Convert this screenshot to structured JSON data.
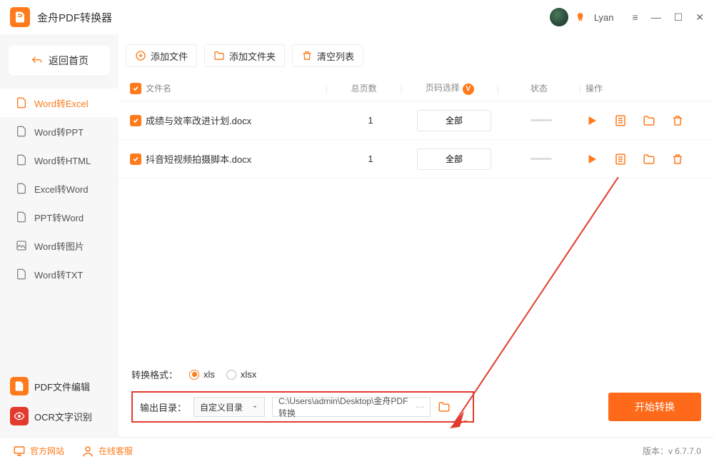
{
  "app": {
    "title": "金舟PDF转换器",
    "username": "Lyan"
  },
  "sidebar": {
    "back_label": "返回首页",
    "items": [
      {
        "label": "Word转Excel"
      },
      {
        "label": "Word转PPT"
      },
      {
        "label": "Word转HTML"
      },
      {
        "label": "Excel转Word"
      },
      {
        "label": "PPT转Word"
      },
      {
        "label": "Word转图片"
      },
      {
        "label": "Word转TXT"
      }
    ],
    "tools": [
      {
        "label": "PDF文件编辑"
      },
      {
        "label": "OCR文字识别"
      }
    ]
  },
  "toolbar": {
    "add_file": "添加文件",
    "add_folder": "添加文件夹",
    "clear_list": "清空列表"
  },
  "columns": {
    "name": "文件名",
    "pages": "总页数",
    "range": "页码选择",
    "status": "状态",
    "ops": "操作"
  },
  "rows": [
    {
      "name": "成绩与效率改进计划.docx",
      "pages": "1",
      "range": "全部"
    },
    {
      "name": "抖音短视频拍摄脚本.docx",
      "pages": "1",
      "range": "全部"
    }
  ],
  "format": {
    "label": "转换格式：",
    "opt1": "xls",
    "opt2": "xlsx"
  },
  "output": {
    "label": "输出目录：",
    "mode": "自定义目录",
    "path": "C:\\Users\\admin\\Desktop\\金舟PDF转换"
  },
  "start_btn": "开始转换",
  "footer": {
    "site": "官方网站",
    "support": "在线客服",
    "version": "版本：v 6.7.7.0"
  }
}
